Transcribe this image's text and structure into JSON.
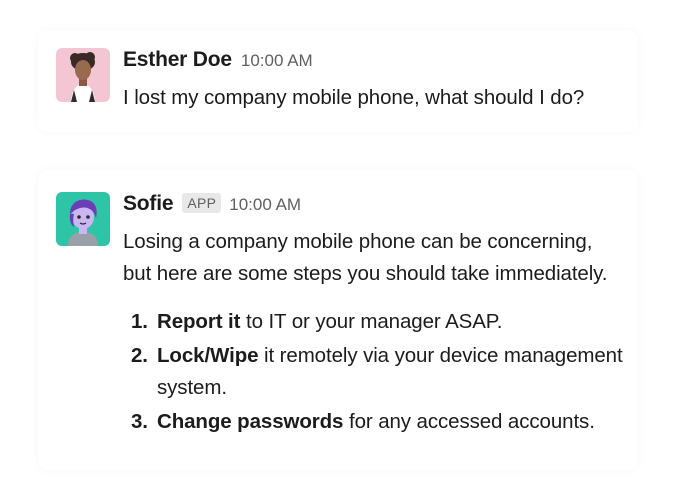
{
  "messages": [
    {
      "author": "Esther Doe",
      "time": "10:00 AM",
      "text": "I lost my company mobile phone, what should I do?",
      "avatar": "person-avatar"
    },
    {
      "author": "Sofie",
      "badge": "APP",
      "time": "10:00 AM",
      "text": "Losing a company mobile phone can be concerning, but here are some steps you should take immediately.",
      "avatar": "bot-avatar",
      "steps": [
        {
          "num": "1.",
          "bold": "Report it",
          "rest": " to IT or your manager ASAP."
        },
        {
          "num": "2.",
          "bold": "Lock/Wipe",
          "rest": " it remotely via your device management system."
        },
        {
          "num": "3.",
          "bold": "Change passwords",
          "rest": " for any accessed accounts."
        }
      ]
    }
  ],
  "colors": {
    "text": "#1d1c1d",
    "muted": "#616061",
    "badge_bg": "#e8e8e8"
  }
}
